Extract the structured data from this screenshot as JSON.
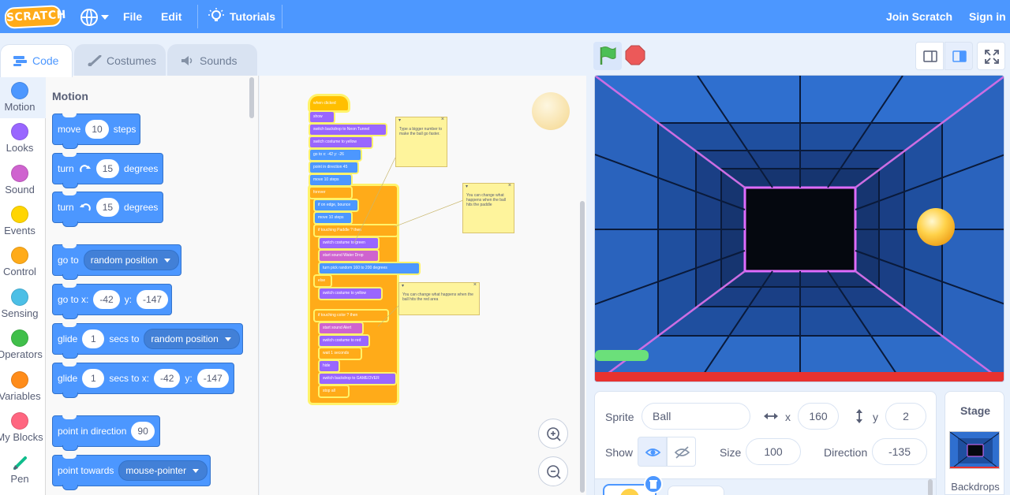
{
  "menubar": {
    "logo": "SCRATCH",
    "file": "File",
    "edit": "Edit",
    "tutorials": "Tutorials",
    "join": "Join Scratch",
    "signin": "Sign in",
    "bg_color": "#4c97ff"
  },
  "tabs": [
    {
      "label": "Code",
      "icon": "code-icon",
      "active": true
    },
    {
      "label": "Costumes",
      "icon": "brush-icon",
      "active": false
    },
    {
      "label": "Sounds",
      "icon": "speaker-icon",
      "active": false
    }
  ],
  "categories": [
    {
      "label": "Motion",
      "color": "#4c97ff"
    },
    {
      "label": "Looks",
      "color": "#9966ff"
    },
    {
      "label": "Sound",
      "color": "#cf63cf"
    },
    {
      "label": "Events",
      "color": "#ffd500"
    },
    {
      "label": "Control",
      "color": "#ffab19"
    },
    {
      "label": "Sensing",
      "color": "#4cbfe6"
    },
    {
      "label": "Operators",
      "color": "#40bf4a"
    },
    {
      "label": "Variables",
      "color": "#ff8c1a"
    },
    {
      "label": "My Blocks",
      "color": "#ff6680"
    },
    {
      "label": "Pen",
      "color": "#0fbd8c"
    }
  ],
  "palette": {
    "title": "Motion",
    "blocks": {
      "move": {
        "t1": "move",
        "v": "10",
        "t2": "steps"
      },
      "turn_right": {
        "t1": "turn",
        "v": "15",
        "t2": "degrees"
      },
      "turn_left": {
        "t1": "turn",
        "v": "15",
        "t2": "degrees"
      },
      "goto": {
        "t1": "go to",
        "drop": "random position"
      },
      "gotoxy": {
        "t1": "go to x:",
        "x": "-42",
        "t2": "y:",
        "y": "-147"
      },
      "glide_to": {
        "t1": "glide",
        "v": "1",
        "t2": "secs to",
        "drop": "random position"
      },
      "glide_xy": {
        "t1": "glide",
        "v": "1",
        "t2": "secs to x:",
        "x": "-42",
        "t3": "y:",
        "y": "-147"
      },
      "point_dir": {
        "t1": "point in direction",
        "v": "90"
      },
      "point_towards": {
        "t1": "point towards",
        "drop": "mouse-pointer"
      }
    }
  },
  "script": {
    "hat": "when clicked",
    "blocks": [
      "show",
      "switch backdrop to Neon Tunnel",
      "switch costume to yellow",
      "go to x: -42 y: -26",
      "point in direction 45",
      "move 10 steps",
      "forever",
      "if on edge, bounce",
      "move 10 steps",
      "if touching Paddle ? then",
      "switch costume to green",
      "start sound Water Drop",
      "turn pick random 160 to 200 degrees",
      "else",
      "switch costume to yellow",
      "if touching color ? then",
      "start sound Alert",
      "switch costume to red",
      "wait 1 seconds",
      "hide",
      "switch backdrop to GAMEOVER",
      "stop all"
    ],
    "notes": [
      "Type a bigger number to make the ball go faster.",
      "You can change what happens when the ball hits the paddle",
      "You can change what happens when the ball hits the red area"
    ]
  },
  "sprite_info": {
    "sprite_label": "Sprite",
    "sprite_name": "Ball",
    "x_label": "x",
    "x_value": "160",
    "y_label": "y",
    "y_value": "2",
    "show_label": "Show",
    "size_label": "Size",
    "size_value": "100",
    "direction_label": "Direction",
    "direction_value": "-135"
  },
  "stage_pane": {
    "title": "Stage",
    "backdrops": "Backdrops"
  }
}
